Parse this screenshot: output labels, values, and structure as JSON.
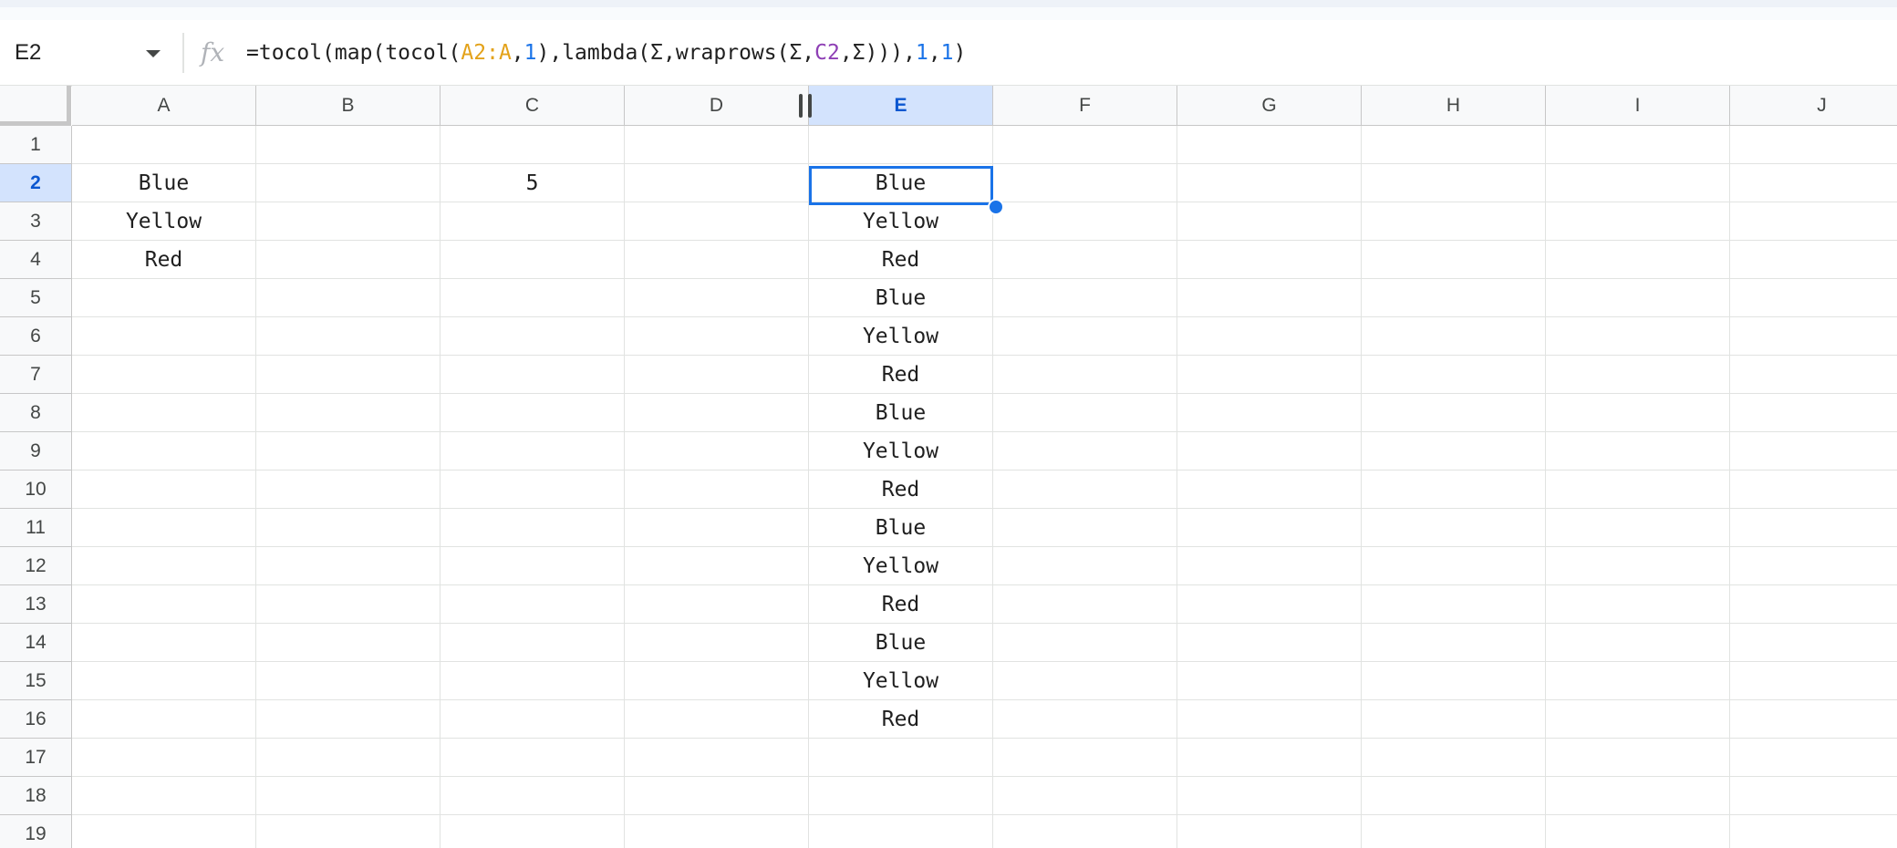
{
  "formula_bar": {
    "name_box": "E2",
    "fx_icon": "fx-icon",
    "formula_tokens": [
      {
        "text": "=tocol(map(tocol(",
        "kind": "plain"
      },
      {
        "text": "A2:A",
        "kind": "range1"
      },
      {
        "text": ",",
        "kind": "plain"
      },
      {
        "text": "1",
        "kind": "num"
      },
      {
        "text": "),lambda(Σ,wraprows(Σ,",
        "kind": "plain"
      },
      {
        "text": "C2",
        "kind": "range2"
      },
      {
        "text": ",Σ))),",
        "kind": "plain"
      },
      {
        "text": "1",
        "kind": "num"
      },
      {
        "text": ",",
        "kind": "plain"
      },
      {
        "text": "1",
        "kind": "num"
      },
      {
        "text": ")",
        "kind": "plain"
      }
    ],
    "colors": {
      "range1": "#e3a21a",
      "num": "#1a73e8",
      "range2": "#8e3fb5"
    }
  },
  "sheet": {
    "selected_cell": "E2",
    "selection_color": "#1a73e8",
    "columns": [
      "A",
      "B",
      "C",
      "D",
      "E",
      "F",
      "G",
      "H",
      "I",
      "J"
    ],
    "rows": [
      "1",
      "2",
      "3",
      "4",
      "5",
      "6",
      "7",
      "8",
      "9",
      "10",
      "11",
      "12",
      "13",
      "14",
      "15",
      "16",
      "17",
      "18",
      "19"
    ],
    "cells": {
      "A2": "Blue",
      "A3": "Yellow",
      "A4": "Red",
      "C2": "5",
      "E2": "Blue",
      "E3": "Yellow",
      "E4": "Red",
      "E5": "Blue",
      "E6": "Yellow",
      "E7": "Red",
      "E8": "Blue",
      "E9": "Yellow",
      "E10": "Red",
      "E11": "Blue",
      "E12": "Yellow",
      "E13": "Red",
      "E14": "Blue",
      "E15": "Yellow",
      "E16": "Red"
    }
  }
}
